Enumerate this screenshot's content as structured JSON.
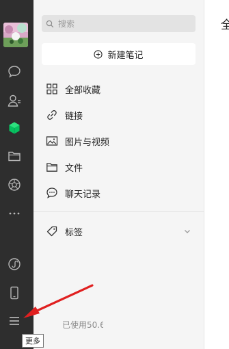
{
  "sidebar": {
    "icons": [
      "chat-icon",
      "contacts-icon",
      "favorites-icon",
      "folder-icon",
      "moments-icon",
      "more-dots-icon",
      "mini-program-icon",
      "phone-icon",
      "menu-icon"
    ],
    "active_color": "#07c160",
    "tooltip": "更多"
  },
  "favorites": {
    "search_placeholder": "搜索",
    "new_note_label": "新建笔记",
    "items": [
      {
        "label": "全部收藏",
        "icon": "grid-icon"
      },
      {
        "label": "链接",
        "icon": "link-icon"
      },
      {
        "label": "图片与视频",
        "icon": "image-icon"
      },
      {
        "label": "文件",
        "icon": "folder-outline-icon"
      },
      {
        "label": "聊天记录",
        "icon": "chat-history-icon"
      }
    ],
    "tags_label": "标签",
    "storage_text": "已使用50.6"
  },
  "content": {
    "title": "全"
  },
  "annotation": {
    "arrow_color": "#e02020"
  }
}
